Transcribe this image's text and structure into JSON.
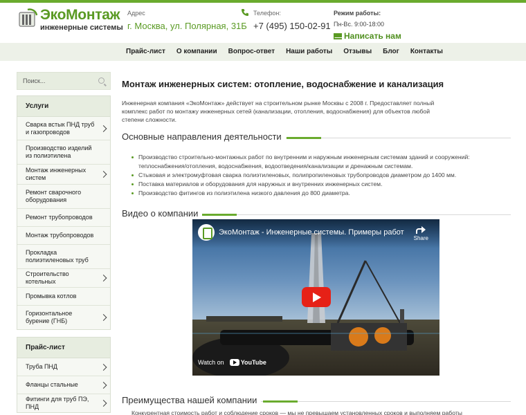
{
  "header": {
    "logo_title_part1": "Эко",
    "logo_title_part2": "Монтаж",
    "logo_subtitle": "инженерные системы",
    "address_label": "Адрес",
    "address_value": "г. Москва, ул. Полярная, 31Б",
    "phone_label": "Телефон:",
    "phone_value": "+7 (495) 150-02-91",
    "hours_label": "Режим работы:",
    "hours_value": "Пн-Вс. 9:00-18:00",
    "write_label": "Написать нам"
  },
  "nav": {
    "items": [
      "Прайс-лист",
      "О компании",
      "Вопрос-ответ",
      "Наши работы",
      "Отзывы",
      "Блог",
      "Контакты"
    ]
  },
  "sidebar": {
    "search_placeholder": "Поиск...",
    "services_title": "Услуги",
    "services": [
      {
        "label": "Сварка встык ПНД труб и газопроводов",
        "has_sub": true
      },
      {
        "label": "Производство изделий из полиэтилена",
        "has_sub": false
      },
      {
        "label": "Монтаж инженерных систем",
        "has_sub": true
      },
      {
        "label": "Ремонт сварочного оборудования",
        "has_sub": false
      },
      {
        "label": "Ремонт трубопроводов",
        "has_sub": false
      },
      {
        "label": "Монтаж трубопроводов",
        "has_sub": false
      },
      {
        "label": "Прокладка полиэтиленовых труб",
        "has_sub": false
      },
      {
        "label": "Строительство котельных",
        "has_sub": true
      },
      {
        "label": "Промывка котлов",
        "has_sub": false
      },
      {
        "label": "Горизонтальное бурение (ГНБ)",
        "has_sub": true
      }
    ],
    "price_title": "Прайс-лист",
    "price": [
      {
        "label": "Труба ПНД",
        "has_sub": true
      },
      {
        "label": "Фланцы стальные",
        "has_sub": true
      },
      {
        "label": "Фитинги для труб ПЭ, ПНД",
        "has_sub": true
      }
    ]
  },
  "main": {
    "title": "Монтаж инженерных систем: отопление, водоснабжение и канализация",
    "intro": "Инженерная компания «ЭкоМонтаж» действует на строительном рынке Москвы с 2008 г. Предоставляет полный комплекс работ по монтажу инженерных сетей (канализации, отопления, водоснабжения) для объектов любой степени сложности.",
    "directions_title": "Основные направления деятельности",
    "directions": [
      "Производство строительно-монтажных работ по внутренним и наружным инженерным системам зданий и сооружений: теплоснабжения/отопления, водоснабжения, водоотведения/канализации и дренажным системам.",
      "Стыковая и электромуфтовая сварка полиэтиленовых, полипропиленовых трубопроводов диаметром до 1400 мм.",
      "Поставка материалов и оборудования для наружных и внутренних инженерных систем.",
      "Производство фитингов из полиэтилена низкого давления до 800 диаметра."
    ],
    "video_title": "Видео о компании",
    "video": {
      "title": "ЭкоМонтаж - Инженерные системы. Примеры работ",
      "share_label": "Share",
      "watch_on": "Watch on",
      "youtube": "YouTube"
    },
    "advantages_title": "Преимущества нашей компании",
    "advantages_text": "Конкурентная стоимость работ и соблюдение сроков — мы не превышаем установленных сроков и выполняем работы"
  },
  "colors": {
    "brand_green": "#5a9a23",
    "accent_green": "#6aab2e",
    "nav_bg": "#edf1e8",
    "youtube_red": "#e62117"
  }
}
